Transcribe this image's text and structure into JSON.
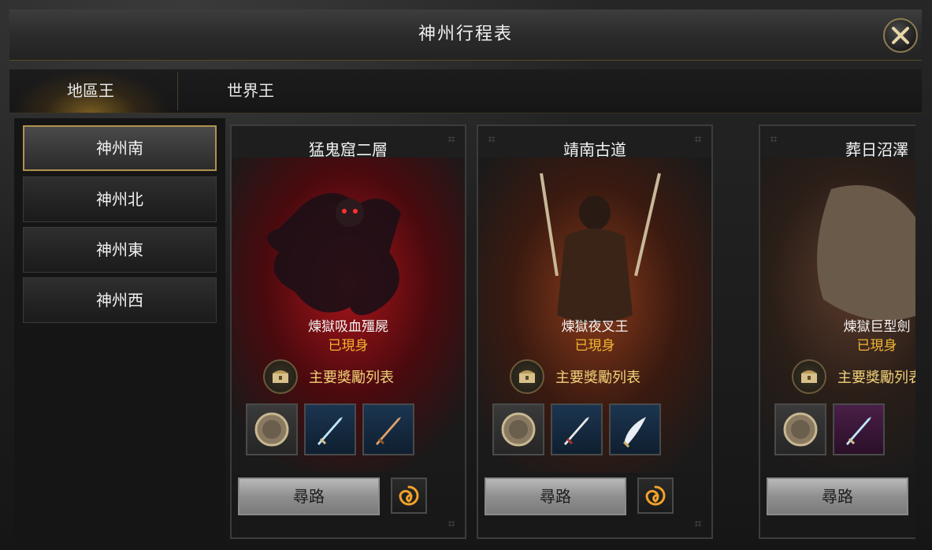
{
  "window": {
    "title": "神州行程表"
  },
  "tabs": [
    {
      "label": "地區王",
      "active": true
    },
    {
      "label": "世界王",
      "active": false
    }
  ],
  "regions": [
    {
      "label": "神州南",
      "selected": true
    },
    {
      "label": "神州北",
      "selected": false
    },
    {
      "label": "神州東",
      "selected": false
    },
    {
      "label": "神州西",
      "selected": false
    }
  ],
  "cards": [
    {
      "location": "猛鬼窟二層",
      "boss_name": "煉獄吸血殭屍",
      "status": "已現身",
      "reward_label": "主要獎勵列表",
      "route_label": "尋路",
      "items": [
        "shield-icon",
        "sword-icon",
        "sword-icon"
      ]
    },
    {
      "location": "靖南古道",
      "boss_name": "煉獄夜叉王",
      "status": "已現身",
      "reward_label": "主要獎勵列表",
      "route_label": "尋路",
      "items": [
        "shield-icon",
        "sword-icon",
        "scimitar-icon"
      ]
    },
    {
      "location": "葬日沼澤",
      "boss_name": "煉獄巨型劍",
      "status": "已現身",
      "reward_label": "主要獎勵列表",
      "route_label": "尋路",
      "items": [
        "shield-icon",
        "sword-icon"
      ]
    }
  ],
  "colors": {
    "status": "#f2b632",
    "reward_label": "#f2d27a",
    "accent_gold": "#b0924e"
  }
}
